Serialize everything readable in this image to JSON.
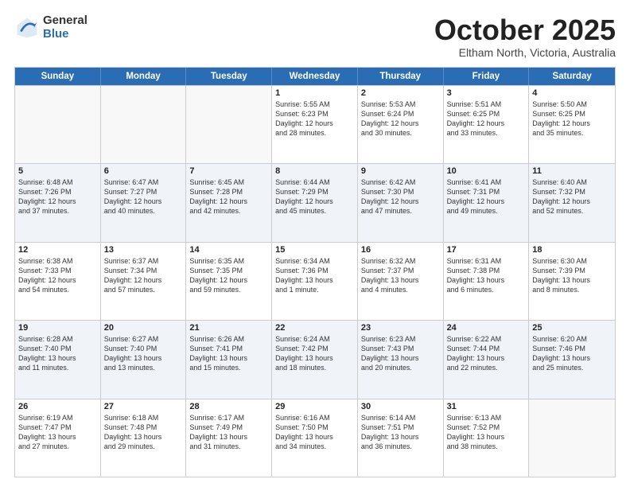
{
  "header": {
    "logo_general": "General",
    "logo_blue": "Blue",
    "month_title": "October 2025",
    "location": "Eltham North, Victoria, Australia"
  },
  "days_of_week": [
    "Sunday",
    "Monday",
    "Tuesday",
    "Wednesday",
    "Thursday",
    "Friday",
    "Saturday"
  ],
  "rows": [
    [
      {
        "day": "",
        "lines": [],
        "empty": true
      },
      {
        "day": "",
        "lines": [],
        "empty": true
      },
      {
        "day": "",
        "lines": [],
        "empty": true
      },
      {
        "day": "1",
        "lines": [
          "Sunrise: 5:55 AM",
          "Sunset: 6:23 PM",
          "Daylight: 12 hours",
          "and 28 minutes."
        ]
      },
      {
        "day": "2",
        "lines": [
          "Sunrise: 5:53 AM",
          "Sunset: 6:24 PM",
          "Daylight: 12 hours",
          "and 30 minutes."
        ]
      },
      {
        "day": "3",
        "lines": [
          "Sunrise: 5:51 AM",
          "Sunset: 6:25 PM",
          "Daylight: 12 hours",
          "and 33 minutes."
        ]
      },
      {
        "day": "4",
        "lines": [
          "Sunrise: 5:50 AM",
          "Sunset: 6:25 PM",
          "Daylight: 12 hours",
          "and 35 minutes."
        ]
      }
    ],
    [
      {
        "day": "5",
        "lines": [
          "Sunrise: 6:48 AM",
          "Sunset: 7:26 PM",
          "Daylight: 12 hours",
          "and 37 minutes."
        ]
      },
      {
        "day": "6",
        "lines": [
          "Sunrise: 6:47 AM",
          "Sunset: 7:27 PM",
          "Daylight: 12 hours",
          "and 40 minutes."
        ]
      },
      {
        "day": "7",
        "lines": [
          "Sunrise: 6:45 AM",
          "Sunset: 7:28 PM",
          "Daylight: 12 hours",
          "and 42 minutes."
        ]
      },
      {
        "day": "8",
        "lines": [
          "Sunrise: 6:44 AM",
          "Sunset: 7:29 PM",
          "Daylight: 12 hours",
          "and 45 minutes."
        ]
      },
      {
        "day": "9",
        "lines": [
          "Sunrise: 6:42 AM",
          "Sunset: 7:30 PM",
          "Daylight: 12 hours",
          "and 47 minutes."
        ]
      },
      {
        "day": "10",
        "lines": [
          "Sunrise: 6:41 AM",
          "Sunset: 7:31 PM",
          "Daylight: 12 hours",
          "and 49 minutes."
        ]
      },
      {
        "day": "11",
        "lines": [
          "Sunrise: 6:40 AM",
          "Sunset: 7:32 PM",
          "Daylight: 12 hours",
          "and 52 minutes."
        ]
      }
    ],
    [
      {
        "day": "12",
        "lines": [
          "Sunrise: 6:38 AM",
          "Sunset: 7:33 PM",
          "Daylight: 12 hours",
          "and 54 minutes."
        ]
      },
      {
        "day": "13",
        "lines": [
          "Sunrise: 6:37 AM",
          "Sunset: 7:34 PM",
          "Daylight: 12 hours",
          "and 57 minutes."
        ]
      },
      {
        "day": "14",
        "lines": [
          "Sunrise: 6:35 AM",
          "Sunset: 7:35 PM",
          "Daylight: 12 hours",
          "and 59 minutes."
        ]
      },
      {
        "day": "15",
        "lines": [
          "Sunrise: 6:34 AM",
          "Sunset: 7:36 PM",
          "Daylight: 13 hours",
          "and 1 minute."
        ]
      },
      {
        "day": "16",
        "lines": [
          "Sunrise: 6:32 AM",
          "Sunset: 7:37 PM",
          "Daylight: 13 hours",
          "and 4 minutes."
        ]
      },
      {
        "day": "17",
        "lines": [
          "Sunrise: 6:31 AM",
          "Sunset: 7:38 PM",
          "Daylight: 13 hours",
          "and 6 minutes."
        ]
      },
      {
        "day": "18",
        "lines": [
          "Sunrise: 6:30 AM",
          "Sunset: 7:39 PM",
          "Daylight: 13 hours",
          "and 8 minutes."
        ]
      }
    ],
    [
      {
        "day": "19",
        "lines": [
          "Sunrise: 6:28 AM",
          "Sunset: 7:40 PM",
          "Daylight: 13 hours",
          "and 11 minutes."
        ]
      },
      {
        "day": "20",
        "lines": [
          "Sunrise: 6:27 AM",
          "Sunset: 7:40 PM",
          "Daylight: 13 hours",
          "and 13 minutes."
        ]
      },
      {
        "day": "21",
        "lines": [
          "Sunrise: 6:26 AM",
          "Sunset: 7:41 PM",
          "Daylight: 13 hours",
          "and 15 minutes."
        ]
      },
      {
        "day": "22",
        "lines": [
          "Sunrise: 6:24 AM",
          "Sunset: 7:42 PM",
          "Daylight: 13 hours",
          "and 18 minutes."
        ]
      },
      {
        "day": "23",
        "lines": [
          "Sunrise: 6:23 AM",
          "Sunset: 7:43 PM",
          "Daylight: 13 hours",
          "and 20 minutes."
        ]
      },
      {
        "day": "24",
        "lines": [
          "Sunrise: 6:22 AM",
          "Sunset: 7:44 PM",
          "Daylight: 13 hours",
          "and 22 minutes."
        ]
      },
      {
        "day": "25",
        "lines": [
          "Sunrise: 6:20 AM",
          "Sunset: 7:46 PM",
          "Daylight: 13 hours",
          "and 25 minutes."
        ]
      }
    ],
    [
      {
        "day": "26",
        "lines": [
          "Sunrise: 6:19 AM",
          "Sunset: 7:47 PM",
          "Daylight: 13 hours",
          "and 27 minutes."
        ]
      },
      {
        "day": "27",
        "lines": [
          "Sunrise: 6:18 AM",
          "Sunset: 7:48 PM",
          "Daylight: 13 hours",
          "and 29 minutes."
        ]
      },
      {
        "day": "28",
        "lines": [
          "Sunrise: 6:17 AM",
          "Sunset: 7:49 PM",
          "Daylight: 13 hours",
          "and 31 minutes."
        ]
      },
      {
        "day": "29",
        "lines": [
          "Sunrise: 6:16 AM",
          "Sunset: 7:50 PM",
          "Daylight: 13 hours",
          "and 34 minutes."
        ]
      },
      {
        "day": "30",
        "lines": [
          "Sunrise: 6:14 AM",
          "Sunset: 7:51 PM",
          "Daylight: 13 hours",
          "and 36 minutes."
        ]
      },
      {
        "day": "31",
        "lines": [
          "Sunrise: 6:13 AM",
          "Sunset: 7:52 PM",
          "Daylight: 13 hours",
          "and 38 minutes."
        ]
      },
      {
        "day": "",
        "lines": [],
        "empty": true
      }
    ]
  ]
}
